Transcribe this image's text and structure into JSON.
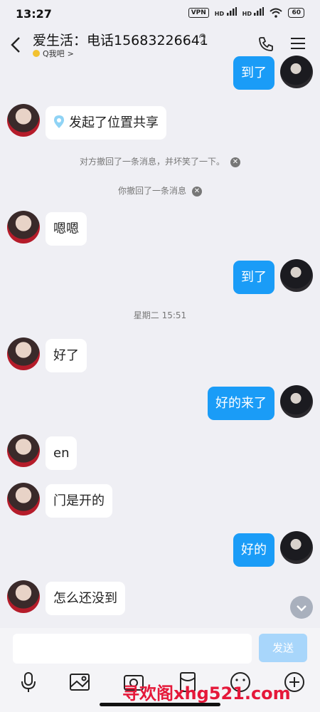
{
  "status_bar": {
    "time": "13:27",
    "vpn": "VPN",
    "hd1": "HD",
    "hd2": "HD",
    "battery": "60"
  },
  "header": {
    "title": "爱生活：电话15683226641",
    "subtitle": "Q我吧",
    "subtitle_arrow": ">"
  },
  "messages": [
    {
      "side": "right",
      "text": "到了"
    },
    {
      "side": "left",
      "text": "发起了位置共享"
    },
    {
      "side": "system",
      "text": "对方撤回了一条消息，并坏笑了一下。"
    },
    {
      "side": "system",
      "text": "你撤回了一条消息"
    },
    {
      "side": "left",
      "text": "嗯嗯"
    },
    {
      "side": "right",
      "text": "到了"
    },
    {
      "side": "time",
      "text": "星期二 15:51"
    },
    {
      "side": "left",
      "text": "好了"
    },
    {
      "side": "right",
      "text": "好的来了"
    },
    {
      "side": "left",
      "text": "en"
    },
    {
      "side": "left",
      "text": "门是开的"
    },
    {
      "side": "right",
      "text": "好的"
    },
    {
      "side": "left",
      "text": "怎么还没到"
    }
  ],
  "input": {
    "value": "",
    "send_label": "发送"
  },
  "watermark": "寻欢阁xhg521.com",
  "colors": {
    "accent": "#1a9cf7",
    "send_disabled": "#a8d6fb",
    "background": "#efeff4"
  }
}
